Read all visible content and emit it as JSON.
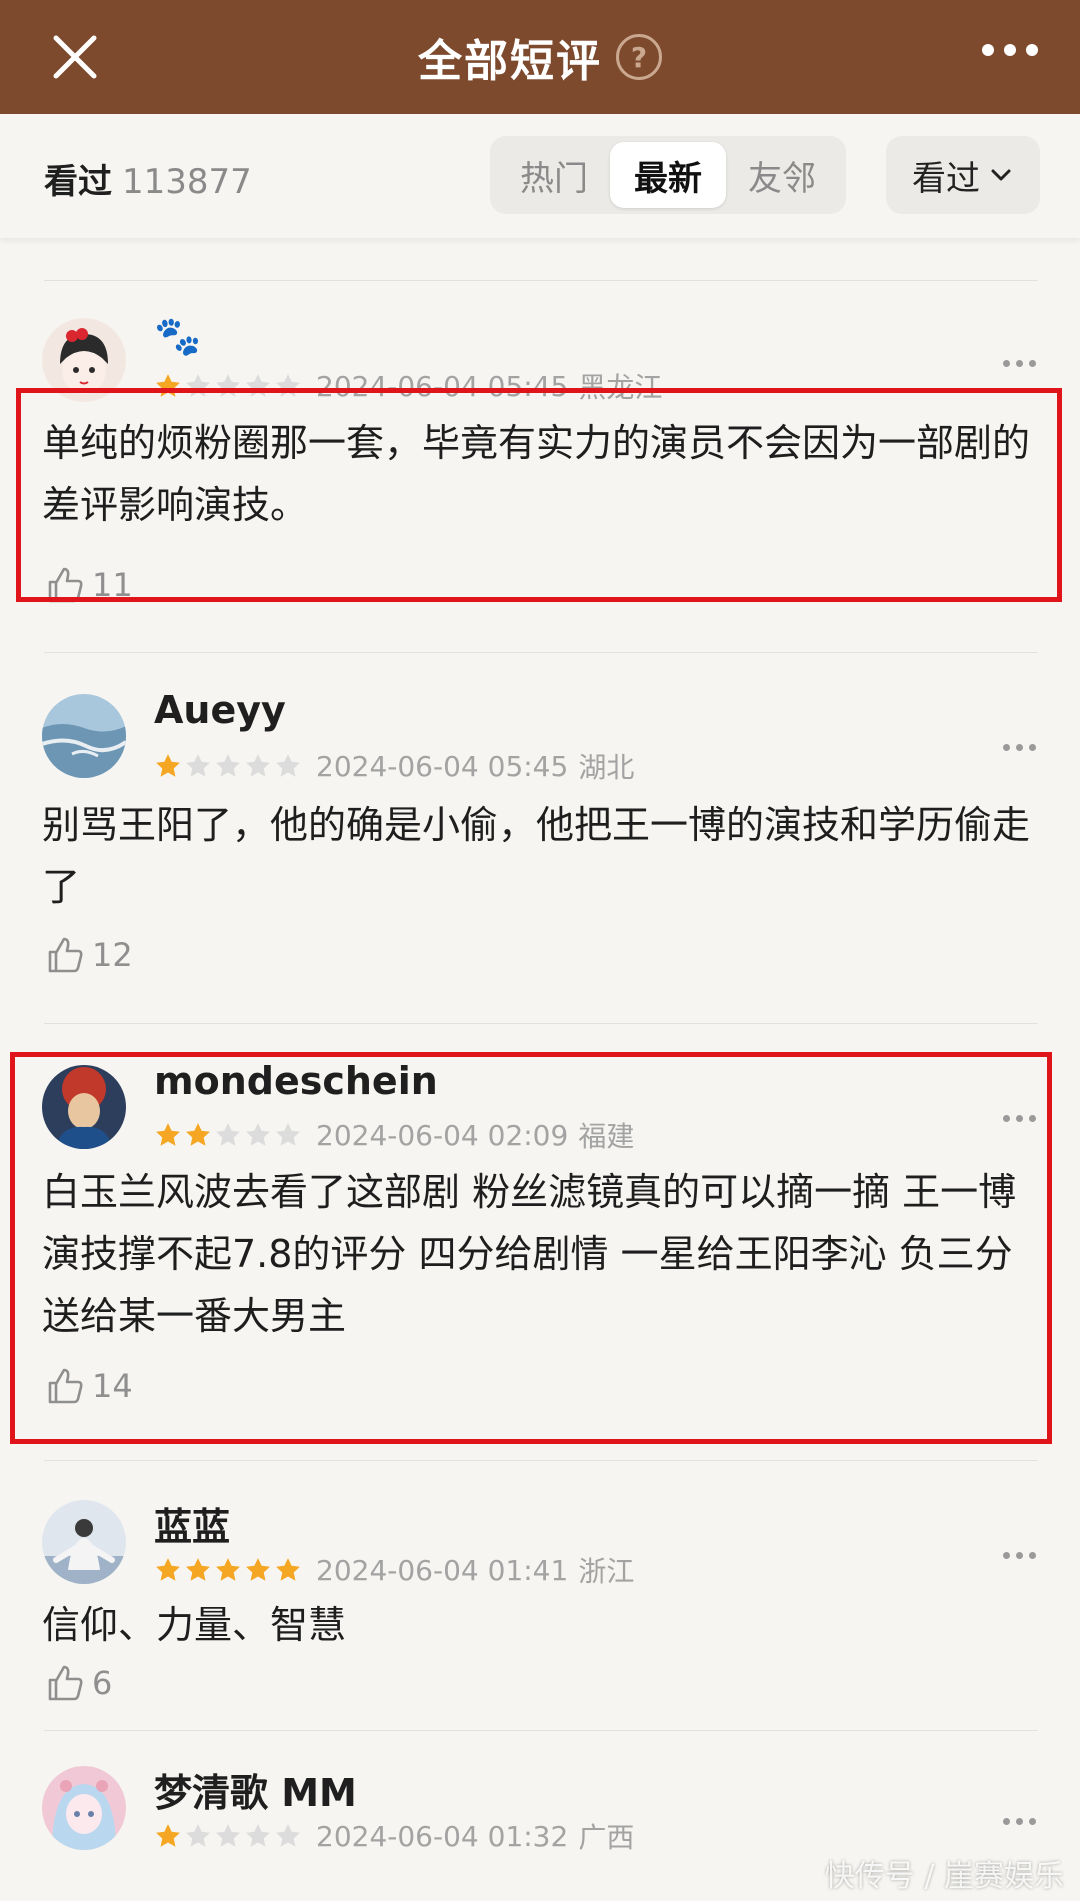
{
  "header": {
    "title": "全部短评",
    "help_glyph": "?"
  },
  "filter": {
    "seen_label": "看过",
    "seen_count": "113877",
    "tabs": [
      {
        "label": "热门",
        "active": false
      },
      {
        "label": "最新",
        "active": true
      },
      {
        "label": "友邻",
        "active": false
      }
    ],
    "dropdown_label": "看过"
  },
  "comments": [
    {
      "username": "🐾",
      "rating": 1,
      "time": "2024-06-04 05:45",
      "location": "黑龙江",
      "text": "单纯的烦粉圈那一套，毕竟有实力的演员不会因为一部剧的差评影响演技。",
      "likes": "11",
      "highlighted": true,
      "avatar_colors": [
        "#f3e7e2",
        "#2b2b2b",
        "#d9262f"
      ]
    },
    {
      "username": "Aueyy",
      "rating": 1,
      "time": "2024-06-04 05:45",
      "location": "湖北",
      "text": "别骂王阳了，他的确是小偷，他把王一博的演技和学历偷走了",
      "likes": "12",
      "highlighted": false,
      "avatar_colors": [
        "#a9c7dc",
        "#6d96b5",
        "#e8eef2"
      ]
    },
    {
      "username": "mondeschein",
      "rating": 2,
      "time": "2024-06-04 02:09",
      "location": "福建",
      "text": "白玉兰风波去看了这部剧 粉丝滤镜真的可以摘一摘 王一博演技撑不起7.8的评分 四分给剧情 一星给王阳李沁 负三分送给某一番大男主",
      "likes": "14",
      "highlighted": true,
      "avatar_colors": [
        "#2c3e5c",
        "#c0392b",
        "#e8c7a0"
      ]
    },
    {
      "username": "蓝蓝",
      "rating": 5,
      "time": "2024-06-04 01:41",
      "location": "浙江",
      "text": "信仰、力量、智慧",
      "likes": "6",
      "highlighted": false,
      "avatar_colors": [
        "#dfe6ee",
        "#9fb2c7",
        "#f4f4f4"
      ]
    },
    {
      "username": "梦清歌 MM",
      "rating": 1,
      "time": "2024-06-04 01:32",
      "location": "广西",
      "text": "",
      "likes": "",
      "highlighted": false,
      "avatar_colors": [
        "#f1c9d6",
        "#b9d7ee",
        "#e9a4b8"
      ]
    }
  ],
  "watermark": "快传号 / 崖赛娱乐",
  "colors": {
    "header_bg": "#7d4a2e",
    "star_on": "#f5a623",
    "star_off": "#dcdcdc",
    "highlight_border": "#e0151b"
  }
}
